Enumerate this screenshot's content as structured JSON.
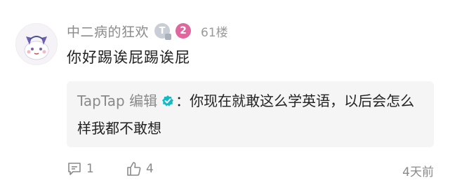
{
  "comment": {
    "username": "中二病的狂欢",
    "badge_letter": "T",
    "level": "2",
    "floor": "61楼",
    "content": "你好踢诶屁踢诶屁",
    "reply": {
      "author": "TapTap 编辑",
      "separator": "：",
      "text": "你现在就敢这么学英语，以后会怎么样我都不敢想"
    },
    "footer": {
      "comment_count": "1",
      "like_count": "4",
      "time": "4天前"
    }
  },
  "icons": {
    "avatar": "avatar-cartoon-icon",
    "verified": "verified-check-icon",
    "comment": "comment-bubble-icon",
    "like": "thumbs-up-icon"
  },
  "colors": {
    "verified": "#14b9c8",
    "level_badge": "#e0669e",
    "reply_background": "#f5f5f5"
  }
}
